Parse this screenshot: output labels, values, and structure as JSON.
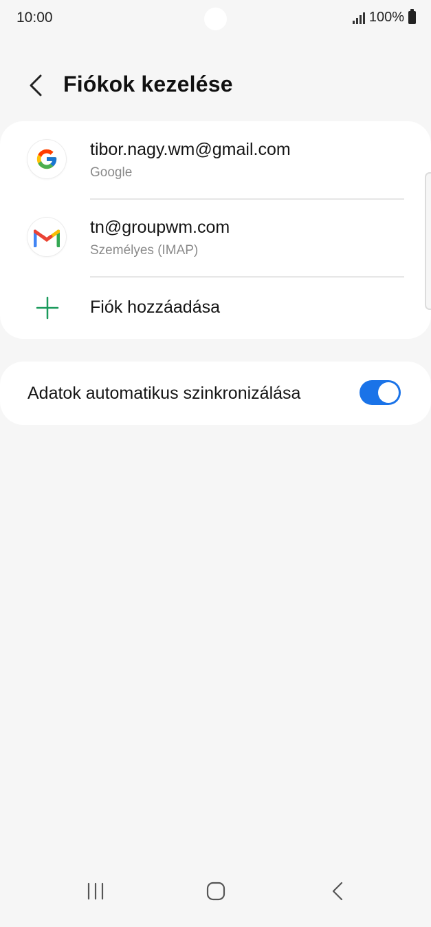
{
  "status_bar": {
    "time": "10:00",
    "battery": "100%"
  },
  "header": {
    "title": "Fiókok kezelése"
  },
  "accounts": [
    {
      "name": "tibor.nagy.wm@gmail.com",
      "type": "Google",
      "icon": "google-icon"
    },
    {
      "name": "tn@groupwm.com",
      "type": "Személyes (IMAP)",
      "icon": "gmail-icon"
    }
  ],
  "add_account": {
    "label": "Fiók hozzáadása"
  },
  "sync": {
    "label": "Adatok automatikus szinkronizálása",
    "enabled": true
  },
  "colors": {
    "accent": "#1a73e8",
    "plus": "#1a9a5c",
    "background": "#f6f6f6"
  }
}
